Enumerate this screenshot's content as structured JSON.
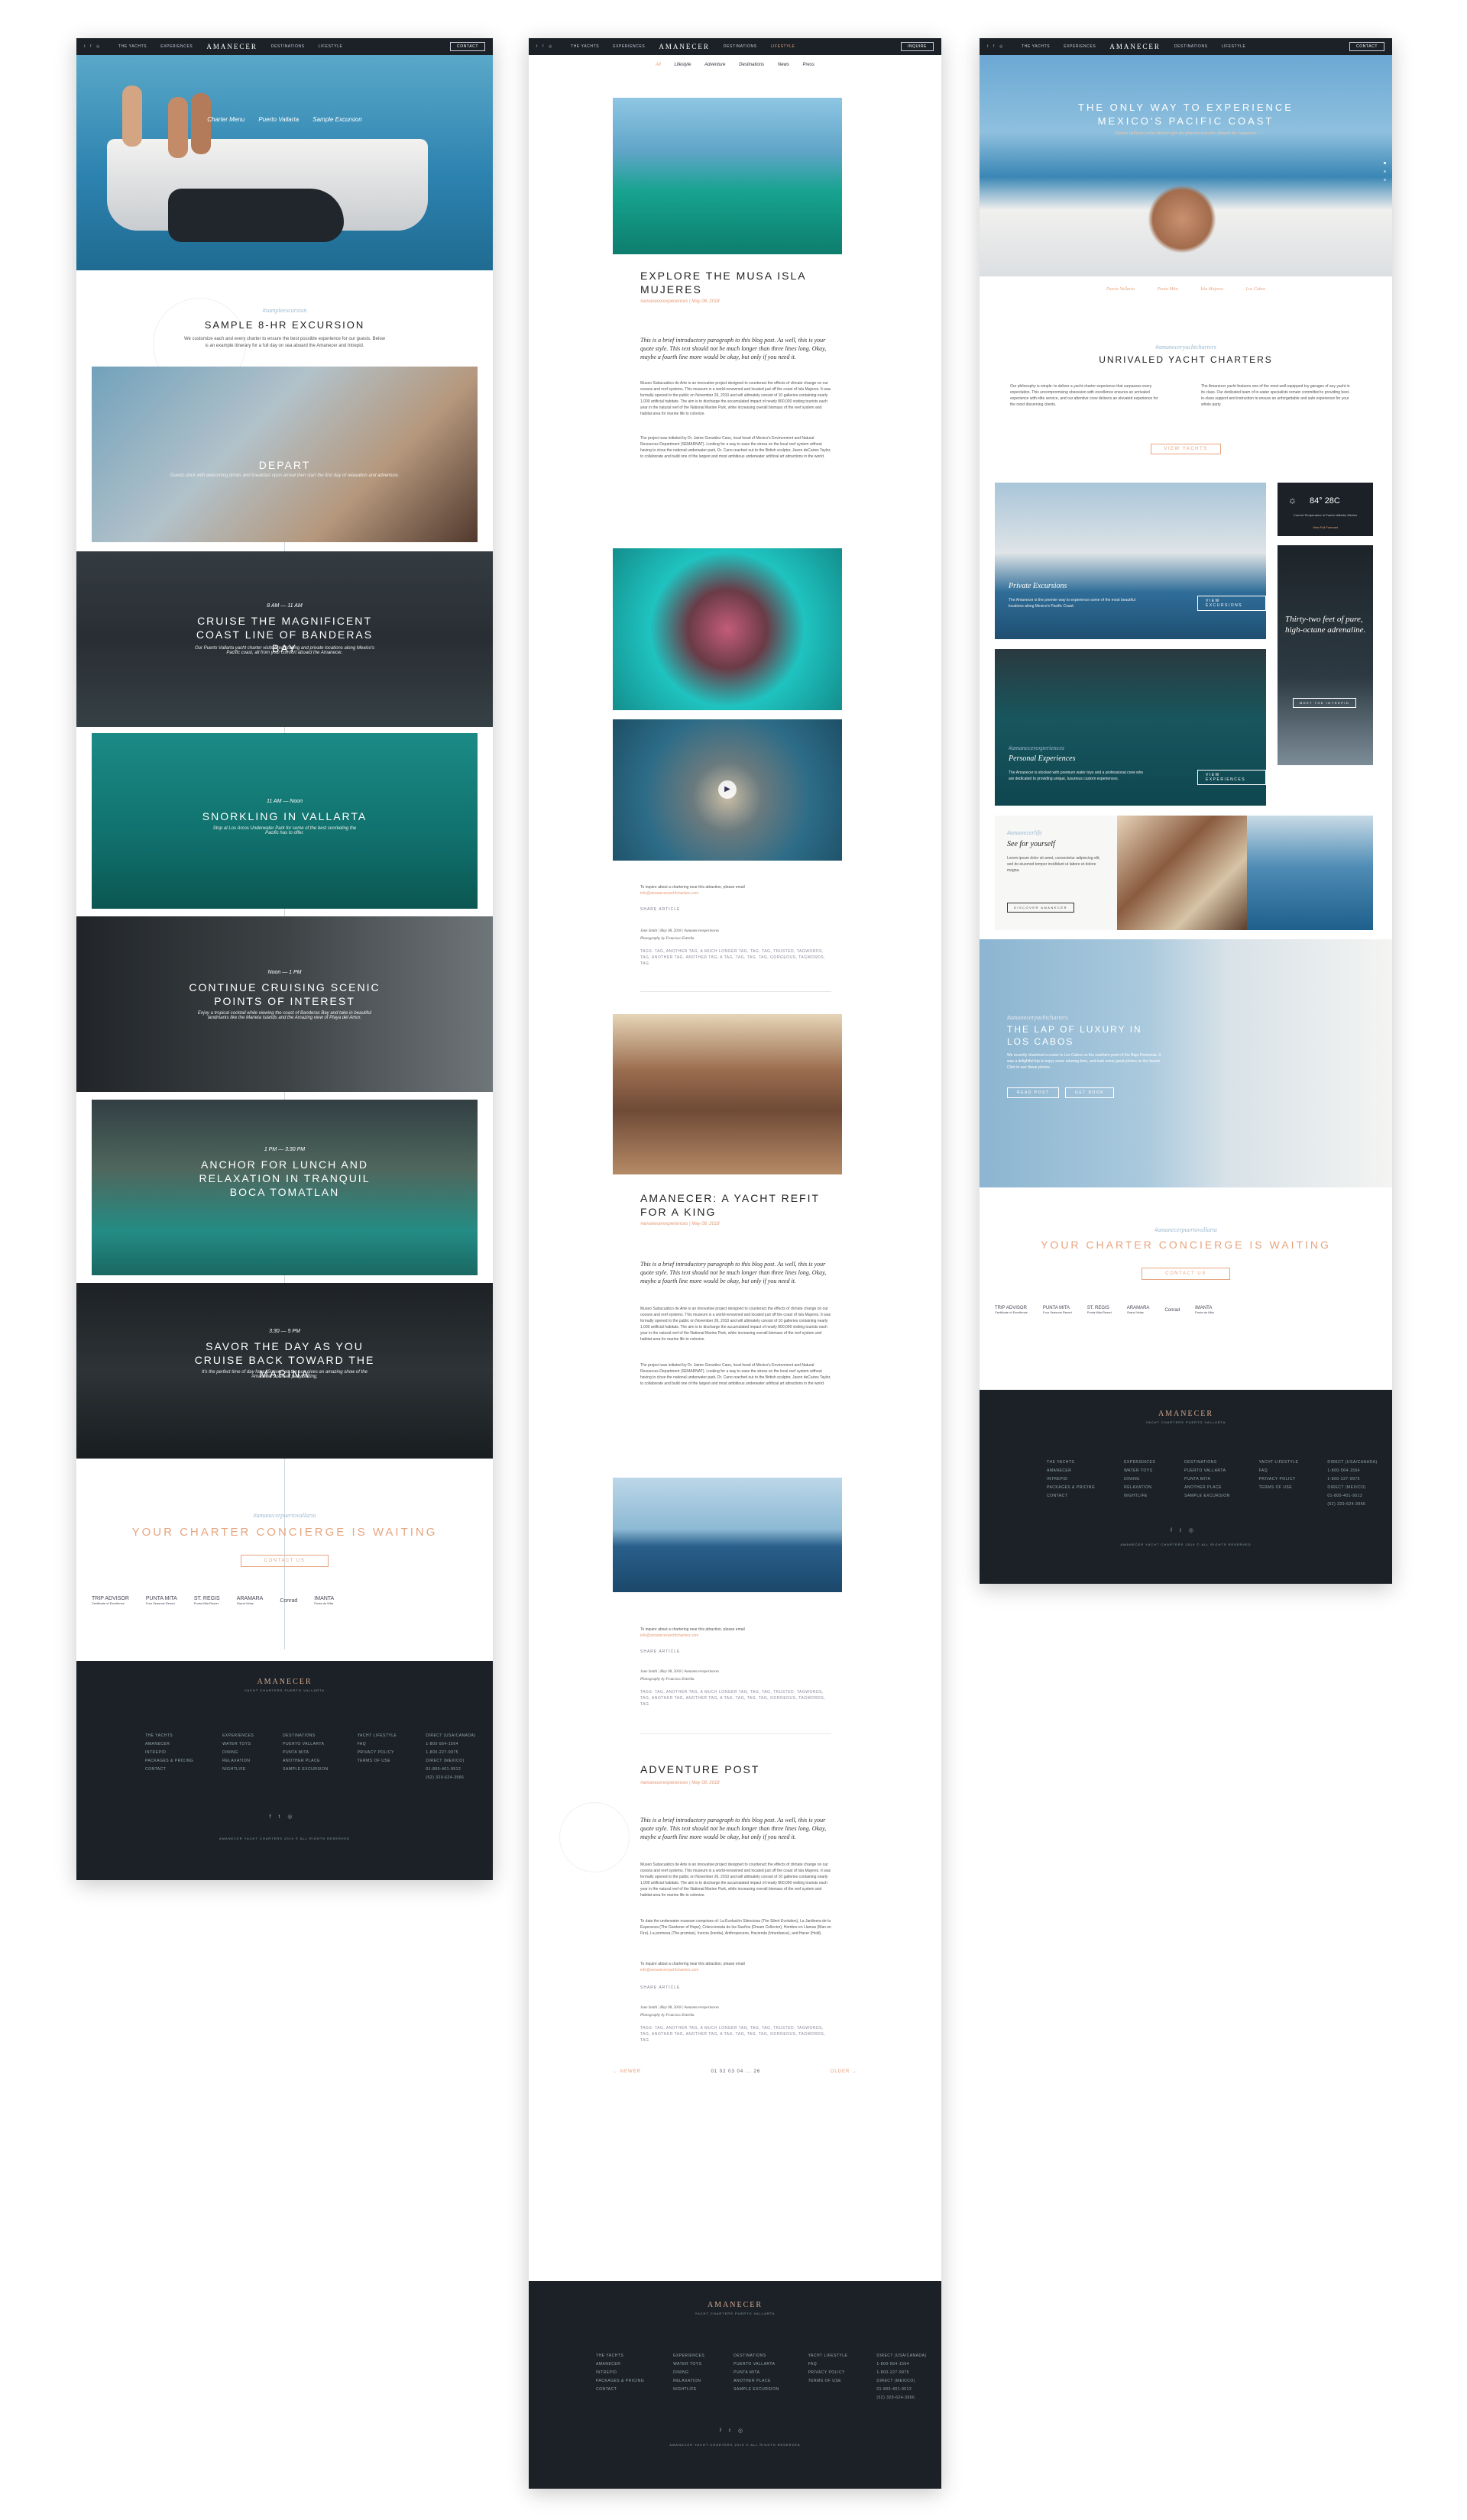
{
  "nav": {
    "social": [
      "t",
      "f",
      "◎"
    ],
    "left_links": [
      "THE YACHTS",
      "EXPERIENCES"
    ],
    "brand": "AMANECER",
    "right_links": [
      "DESTINATIONS",
      "LIFESTYLE"
    ],
    "contact": "CONTACT",
    "inquire": "INQUIRE"
  },
  "p1": {
    "subnav": [
      "Charter Menu",
      "Puerto Vallarta",
      "Sample Excursion"
    ],
    "eyebrow": "#sampleexcursion",
    "title": "SAMPLE 8-HR EXCURSION",
    "intro": "We customize each and every charter to ensure the best possible experience for our guests. Below is an example itinerary for a full day on sea aboard the Amanecer and Intrepid.",
    "cards": [
      {
        "time": "",
        "title": "DEPART",
        "desc": "Guests dock with welcoming drinks and breakfast upon arrival then start the first day of relaxation and adventure."
      },
      {
        "time": "8 AM — 11 AM",
        "title": "CRUISE THE MAGNIFICENT COAST LINE OF BANDERAS BAY",
        "desc": "Our Puerto Vallarta yacht charter visits breathtaking and private locations along Mexico's Pacific coast, all from your comfort aboard the Amanecer."
      },
      {
        "time": "11 AM — Noon",
        "title": "SNORKLING IN VALLARTA",
        "desc": "Stop at Los Arcos Underwater Park for some of the best snorkeling the Pacific has to offer."
      },
      {
        "time": "Noon — 1 PM",
        "title": "CONTINUE CRUISING SCENIC POINTS OF INTEREST",
        "desc": "Enjoy a tropical cocktail while viewing the coast of Banderas Bay and take in beautiful landmarks like the Marieta Islands and the Amazing view of Playa del Amor."
      },
      {
        "time": "1 PM — 3:30 PM",
        "title": "ANCHOR FOR LUNCH AND RELAXATION IN TRANQUIL BOCA TOMATLAN",
        "desc": ""
      },
      {
        "time": "3:30 — 5 PM",
        "title": "SAVOR THE DAY AS YOU CRUISE BACK TOWARD THE MARINA",
        "desc": "It's the perfect time of day for a \"Sunset\" as the sun gives an amazing show of the Amanecer's sunset party setting."
      }
    ],
    "concierge_eyebrow": "#amanecerpuertovallarta",
    "concierge_title": "YOUR CHARTER CONCIERGE IS WAITING",
    "concierge_button": "CONTACT US"
  },
  "partners": [
    {
      "name": "TRIP ADVISOR",
      "sub": "Certificate of Excellence"
    },
    {
      "name": "PUNTA MITA",
      "sub": "Four Seasons Resort"
    },
    {
      "name": "ST. REGIS",
      "sub": "Punta Mita Resort"
    },
    {
      "name": "ARAMARA",
      "sub": "Grand Velas"
    },
    {
      "name": "Conrad",
      "sub": ""
    },
    {
      "name": "IMANTA",
      "sub": "Punta de Mita"
    }
  ],
  "footer": {
    "brand": "AMANECER",
    "tagline": "YACHT CHARTERS PUERTO VALLARTA",
    "cols": [
      [
        "THE YACHTS",
        "AMANECER",
        "INTREPID",
        "PACKAGES & PRICING",
        "CONTACT"
      ],
      [
        "EXPERIENCES",
        "WATER TOYS",
        "DINING",
        "RELAXATION",
        "NIGHTLIFE"
      ],
      [
        "DESTINATIONS",
        "PUERTO VALLARTA",
        "PUNTA MITA",
        "ANOTHER PLACE",
        "SAMPLE EXCURSION"
      ],
      [
        "YACHT LIFESTYLE",
        "FAQ",
        "PRIVACY POLICY",
        "TERMS OF USE"
      ]
    ],
    "contact": [
      "DIRECT (USA/CANADA)",
      "1-800-564-1564",
      "1-800-227-9975",
      "DIRECT (MEXICO)",
      "01-800-401-9512",
      "(52) 329-624-3966"
    ],
    "social": [
      "f",
      "t",
      "◎"
    ],
    "copyright": "AMANECER YACHT CHARTERS 2019 © ALL RIGHTS RESERVED"
  },
  "p2": {
    "filters": [
      "All",
      "Lifestyle",
      "Adventure",
      "Destinations",
      "News",
      "Press"
    ],
    "posts": [
      {
        "title": "EXPLORE THE MUSA ISLA MUJERES",
        "meta": "#amanecerexperiences | May 08, 2018"
      },
      {
        "title": "AMANECER: A YACHT REFIT FOR A KING",
        "meta": "#amanecerexperiences | May 08, 2018"
      },
      {
        "title": "ADVENTURE POST",
        "meta": "#amanecerexperiences | May 08, 2018"
      }
    ],
    "quote": "This is a brief introductory paragraph to this blog post. As well, this is your quote style. This text should not be much longer than three lines long. Okay, maybe a fourth line more would be okay, but only if you need it.",
    "body1": "Museo Subacuático de Arte is an innovative project designed to counteract the effects of climate change on our oceans and reef systems. This museum is a world-renowned and located just off the coast of Isla Mujeres. It was formally opened to the public on November 26, 2010 and will ultimately consist of 10 galleries containing nearly 1,000 artificial habitats. The aim is to discharge the accumulated impact of nearly 800,000 visiting tourists each year in the natural reef of the National Marine Park, while increasing overall biomass of the reef system and habitat area for marine life to colonize.",
    "body2": "The project was initiated by Dr. Jaime González Cano, local head of Mexico's Environment and Natural Resources Department (SEMARNAT). Looking for a way to ease the stress on the local reef system without having to close the national underwater park, Dr. Cano reached out to the British sculptor, Jason deCaires Taylor, to collaborate and build one of the largest and most ambitious underwater artificial art attractions in the world.",
    "inquire": "To inquire about a chartering near this attraction, please email",
    "email": "info@amaneceryachtcharters.com",
    "share": "SHARE ARTICLE",
    "author": "Jane Smith | May 08, 2018 | #amanecerexperiences",
    "credit": "Photography by Francisco Estrella",
    "tags": "TAGS: TAG, ANOTHER TAG, A MUCH LONGER TAG, TAG, TAG, TRUSTED, TAGWORDS, TAG, ANOTHER TAG, ANOTHER TAG, A TAG, TAG, TAG, TAG, GORGEOUS, TAGWORDS, TAG",
    "prev": "← NEWER",
    "pages": "01 02 03 04 ... 26",
    "next": "OLDER →",
    "adventure_body": "To date the underwater museum comprises of: La Evolución Silenciosa (The Silent Evolution), La Jardinera de la Esperanza (The Gardener of Hope), Coleccionista de los Sueños (Dream Collector), Hombre en Llamas (Man on Fire), La promesa (The promise), Inercia (Inertia), Anthropocene, Hacienda (Inheritance), and Hacer (Hold)."
  },
  "p3": {
    "hero_title": "THE ONLY WAY TO EXPERIENCE MEXICO'S PACIFIC COAST",
    "hero_sub": "Puerto Vallarta yacht charters for the premier traveler, aboard the Amanecer",
    "hero_links": [
      "Puerto Vallarta",
      "Punta Mita",
      "Isla Mujeres",
      "Los Cabos"
    ],
    "eyebrow": "#amaneceryachtcharters",
    "title": "UNRIVALED YACHT CHARTERS",
    "col1": "Our philosophy is simple: to deliver a yacht charter experience that surpasses every expectation. This uncompromising obsession with excellence ensures an unrivaled experience with elite service, and our attentive crew delivers an elevated experience for the most discerning clients.",
    "col2": "The Amanecer yacht features one of the most well-equipped toy garages of any yacht in its class. Our dedicated team of in-water specialists remain committed to providing best-in-class support and instruction to ensure an unforgettable and safe experience for your whole party.",
    "view_yachts": "VIEW YACHTS",
    "private_title": "Private Excursions",
    "private_desc": "The Amanecer is the premier way to experience some of the most beautiful locations along Mexico's Pacific Coast.",
    "private_btn": "VIEW EXCURSIONS",
    "weather_temp": "84° 28C",
    "weather_label": "Current Temperature in Puerto Vallarta, Mexico",
    "weather_link": "View Full Forecast",
    "thirty_title": "Thirty-two feet of pure, high-octane adrenaline.",
    "thirty_btn": "MEET THE INTREPID",
    "personal_eyebrow": "#amanecerexperiences",
    "personal_title": "Personal Experiences",
    "personal_desc": "The Amanecer is stocked with premium water toys and a professional crew who are dedicated to providing unique, luxurious custom experiences.",
    "personal_btn": "VIEW EXPERIENCES",
    "see_eyebrow": "#amanecerlife",
    "see_title": "See for yourself",
    "see_desc": "Lorem ipsum dolor sit amet, consectetur adipiscing elit, sed do eiusmod tempor incididunt ut labore et dolore magna.",
    "see_btn": "DISCOVER AMANECER",
    "lap_eyebrow": "#amaneceryachtcharters",
    "lap_title": "THE LAP OF LUXURY IN LOS CABOS",
    "lap_desc": "We recently chartered a cruise to Los Cabos on the southern point of the Baja Peninsula. It was a delightful trip to enjoy some relaxing time, and took some great photos on the beach. Click to see these photos.",
    "lap_btn1": "READ POST",
    "lap_btn2": "GET BOOK",
    "concierge_eyebrow": "#amanecerpuertovallarta",
    "concierge_title": "YOUR CHARTER CONCIERGE IS WAITING",
    "concierge_button": "CONTACT US"
  },
  "colors": {
    "dark": "#1b2127",
    "accent": "#e7a47f",
    "sky": "#9ab8cf"
  }
}
